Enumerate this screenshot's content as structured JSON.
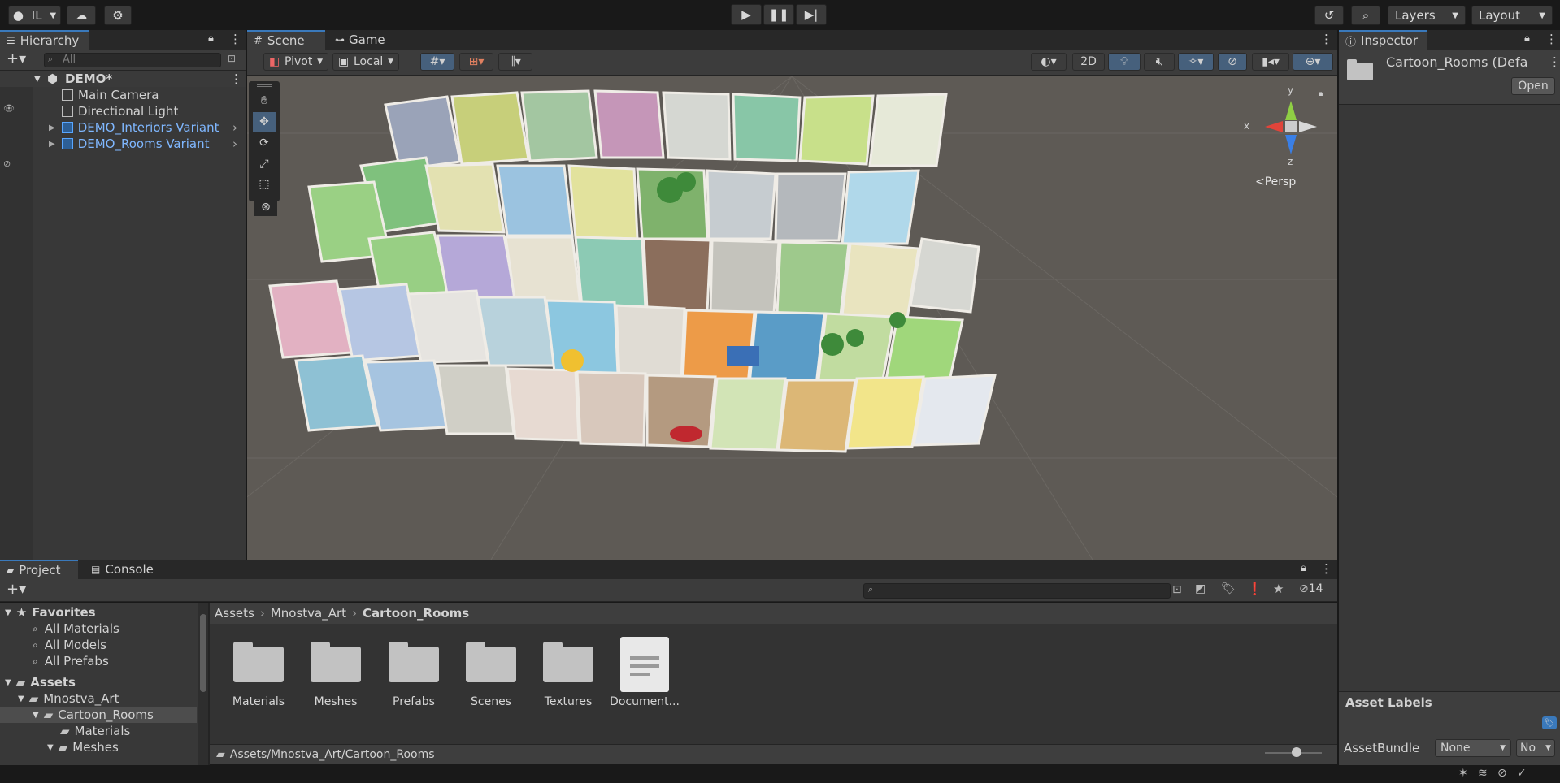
{
  "topbar": {
    "account_label": "IL",
    "layers_label": "Layers",
    "layout_label": "Layout"
  },
  "hierarchy": {
    "tab_label": "Hierarchy",
    "search_placeholder": "All",
    "scene_name": "DEMO*",
    "items": [
      {
        "label": "Main Camera",
        "icon": "gameobject-icon",
        "prefab": false
      },
      {
        "label": "Directional Light",
        "icon": "gameobject-icon",
        "prefab": false
      },
      {
        "label": "DEMO_Interiors Variant",
        "icon": "prefab-variant-icon",
        "prefab": true
      },
      {
        "label": "DEMO_Rooms Variant",
        "icon": "prefab-variant-icon",
        "prefab": true
      }
    ]
  },
  "scene": {
    "tabs": [
      "Scene",
      "Game"
    ],
    "pivot_label": "Pivot",
    "local_label": "Local",
    "mode_2d": "2D",
    "gizmo": {
      "x": "x",
      "y": "y",
      "z": "z",
      "persp": "Persp"
    }
  },
  "inspector": {
    "tab_label": "Inspector",
    "asset_name": "Cartoon_Rooms (Defa",
    "open_button": "Open",
    "asset_labels_title": "Asset Labels",
    "assetbundle_label": "AssetBundle",
    "assetbundle_value": "None",
    "assetbundle_variant": "No"
  },
  "project": {
    "tabs": [
      "Project",
      "Console"
    ],
    "hidden_count": "14",
    "favorites_title": "Favorites",
    "favorites": [
      "All Materials",
      "All Models",
      "All Prefabs"
    ],
    "assets_title": "Assets",
    "tree": [
      "Mnostva_Art",
      "Cartoon_Rooms",
      "Materials",
      "Meshes"
    ],
    "breadcrumb": [
      "Assets",
      "Mnostva_Art",
      "Cartoon_Rooms"
    ],
    "grid_items": [
      {
        "label": "Materials",
        "type": "folder"
      },
      {
        "label": "Meshes",
        "type": "folder"
      },
      {
        "label": "Prefabs",
        "type": "folder"
      },
      {
        "label": "Scenes",
        "type": "folder"
      },
      {
        "label": "Textures",
        "type": "folder"
      },
      {
        "label": "Document...",
        "type": "document"
      }
    ],
    "path": "Assets/Mnostva_Art/Cartoon_Rooms"
  },
  "colors": {
    "accent": "#3a79bb",
    "prefab_text": "#7fb7ff",
    "scene_bg": "#5e5a55"
  }
}
